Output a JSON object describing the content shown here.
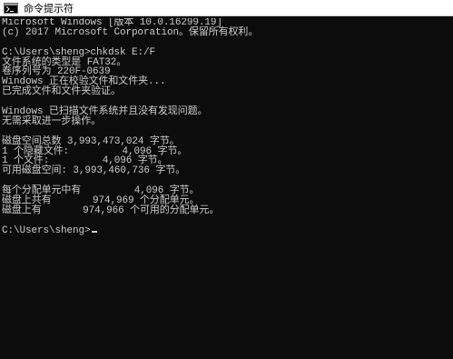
{
  "window": {
    "title": "命令提示符"
  },
  "console": {
    "lines": [
      "Microsoft Windows [版本 10.0.16299.19]",
      "(c) 2017 Microsoft Corporation。保留所有权利。",
      "",
      "C:\\Users\\sheng>chkdsk E:/F",
      "文件系统的类型是 FAT32。",
      "卷序列号为 220F-0639",
      "Windows 正在校验文件和文件夹...",
      "已完成文件和文件夹验证。",
      "",
      "Windows 已扫描文件系统并且没有发现问题。",
      "无需采取进一步操作。",
      "",
      "磁盘空间总数 3,993,473,024 字节。",
      "1 个隐藏文件:         4,096 字节。",
      "1 个文件:         4,096 字节。",
      "可用磁盘空间: 3,993,460,736 字节。",
      "",
      "每个分配单元中有         4,096 字节。",
      "磁盘上共有       974,969 个分配单元。",
      "磁盘上有       974,966 个可用的分配单元。",
      "",
      "C:\\Users\\sheng>"
    ]
  }
}
